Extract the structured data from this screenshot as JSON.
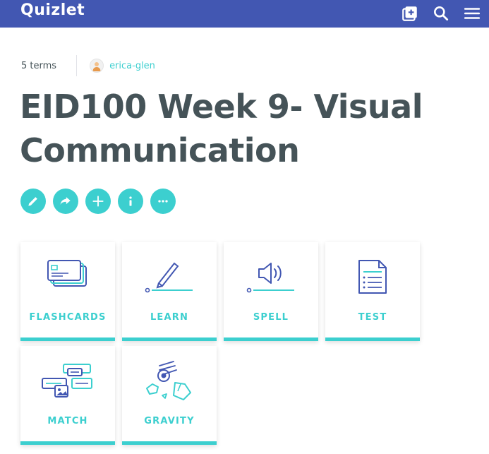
{
  "header": {
    "logo": "Quizlet",
    "icons": [
      "create-set-icon",
      "search-icon",
      "menu-icon"
    ]
  },
  "set": {
    "term_count": "5 terms",
    "author": "erica-glen",
    "title": "EID100 Week 9- Visual Communication"
  },
  "actions": [
    "edit-icon",
    "share-icon",
    "add-icon",
    "info-icon",
    "more-icon"
  ],
  "modes": [
    {
      "label": "FLASHCARDS",
      "icon": "flashcards-icon"
    },
    {
      "label": "LEARN",
      "icon": "learn-icon"
    },
    {
      "label": "SPELL",
      "icon": "spell-icon"
    },
    {
      "label": "TEST",
      "icon": "test-icon"
    },
    {
      "label": "MATCH",
      "icon": "match-icon"
    },
    {
      "label": "GRAVITY",
      "icon": "gravity-icon"
    }
  ],
  "colors": {
    "header_bg": "#4257b2",
    "accent": "#3ccfcf",
    "icon_navy": "#4257b2",
    "text": "#455358"
  }
}
